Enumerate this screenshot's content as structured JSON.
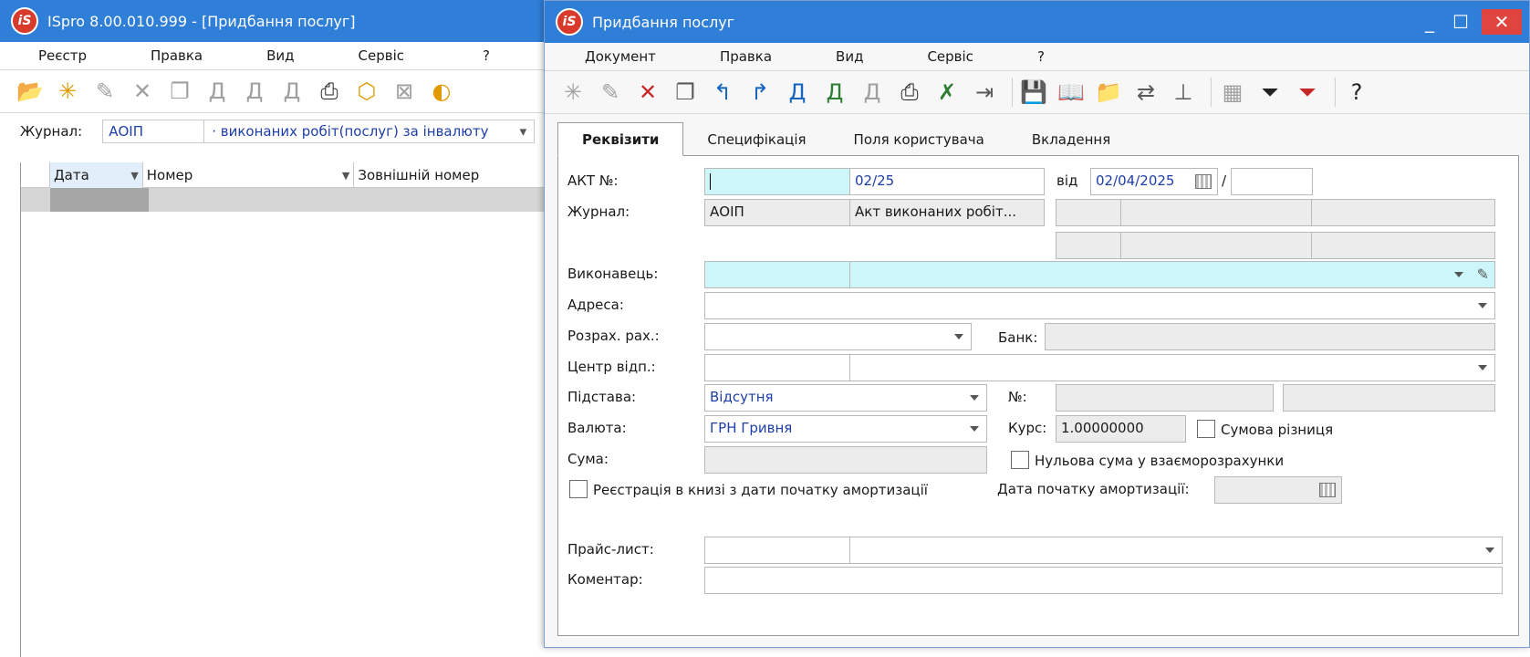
{
  "bg_window": {
    "title": "ISpro 8.00.010.999 - [Придбання послуг]",
    "menu": [
      "Реєстр",
      "Правка",
      "Вид",
      "Сервіс",
      "?"
    ],
    "journal_label": "Журнал:",
    "journal_code": "АОІП",
    "journal_name": "· виконаних робіт(послуг) за інвалюту",
    "columns": [
      "Дата",
      "Номер",
      "Зовнішній номер"
    ]
  },
  "dialog": {
    "title": "Придбання послуг",
    "menu": [
      "Документ",
      "Правка",
      "Вид",
      "Сервіс",
      "?"
    ],
    "tabs": [
      "Реквізити",
      "Специфікація",
      "Поля користувача",
      "Вкладення"
    ],
    "form": {
      "akt_label": "АКТ №:",
      "akt_prefix": "",
      "akt_number": "02/25",
      "vid_label": "від",
      "date": "02/04/2025",
      "slash": "/",
      "journal_label": "Журнал:",
      "journal_code": "АОІП",
      "journal_name": "Акт виконаних робіт...",
      "executor_label": "Виконавець:",
      "address_label": "Адреса:",
      "account_label": "Розрах. рах.:",
      "bank_label": "Банк:",
      "center_label": "Центр відп.:",
      "basis_label": "Підстава:",
      "basis_value": "Відсутня",
      "no_label": "№:",
      "currency_label": "Валюта:",
      "currency_value": "ГРН Гривня",
      "rate_label": "Курс:",
      "rate_value": "1.00000000",
      "sum_diff_label": "Сумова різниця",
      "sum_label": "Сума:",
      "zero_sum_label": "Нульова сума у взаєморозрахунки",
      "registration_label": "Реєстрація в книзі з дати початку амортизації",
      "amort_date_label": "Дата початку амортизації:",
      "pricelist_label": "Прайс-лист:",
      "comment_label": "Коментар:"
    }
  }
}
